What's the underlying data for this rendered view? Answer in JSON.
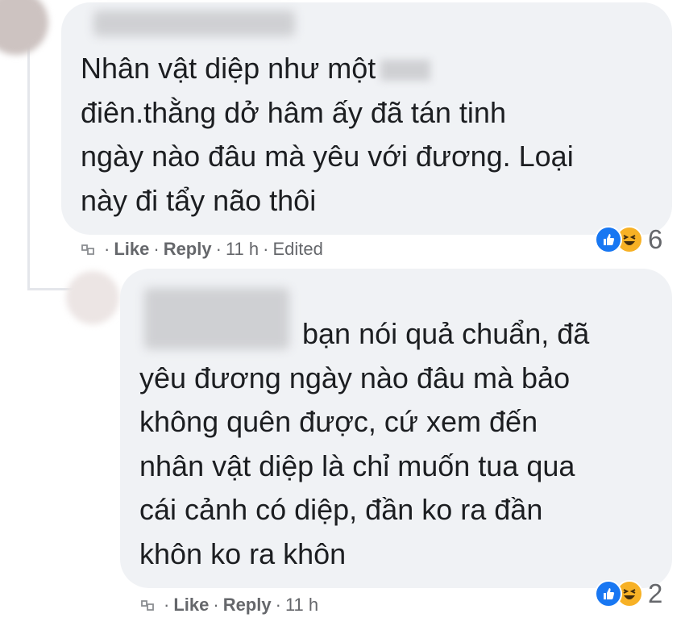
{
  "comments": [
    {
      "text_lines": [
        "Nhân vật diệp như một",
        "điên.thằng dở hâm ấy đã tán tinh",
        "ngày nào đâu mà yêu với đương. Loại",
        "này đi tẩy não thôi"
      ],
      "actions": {
        "like": "Like",
        "reply": "Reply",
        "time": "11 h",
        "edited": "Edited"
      },
      "reaction_count": "6",
      "reaction_icons": [
        "like-icon",
        "haha-icon"
      ]
    },
    {
      "text_lines": [
        "bạn nói quả chuẩn, đã",
        "yêu đương ngày nào đâu mà bảo",
        "không quên được, cứ xem đến",
        "nhân vật diệp là chỉ muốn tua qua",
        "cái cảnh có diệp, đần ko ra đần",
        "khôn ko ra khôn"
      ],
      "actions": {
        "like": "Like",
        "reply": "Reply",
        "time": "11 h"
      },
      "reaction_count": "2",
      "reaction_icons": [
        "like-icon",
        "haha-icon"
      ]
    }
  ],
  "colors": {
    "bubble": "#f0f2f5",
    "meta_text": "#65676b",
    "like_blue": "#1877f2",
    "haha_yellow": "#f7b125",
    "thread_line": "#e4e6eb"
  }
}
